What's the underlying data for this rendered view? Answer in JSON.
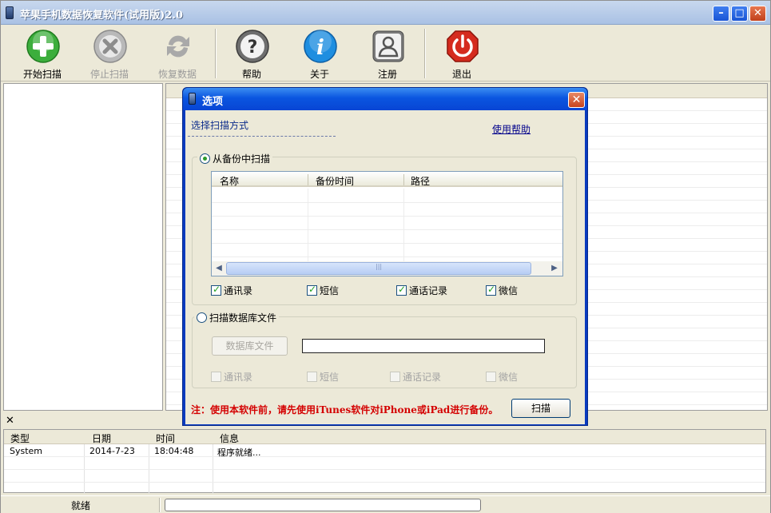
{
  "window": {
    "title": "苹果手机数据恢复软件(试用版)2.0",
    "controls": [
      "minimize",
      "maximize",
      "close"
    ]
  },
  "toolbar": {
    "start_scan": "开始扫描",
    "stop_scan": "停止扫描",
    "recover_data": "恢复数据",
    "help": "帮助",
    "about": "关于",
    "register": "注册",
    "exit": "退出"
  },
  "log": {
    "columns": [
      "类型",
      "日期",
      "时间",
      "信息"
    ],
    "rows": [
      {
        "type": "System",
        "date": "2014-7-23",
        "time": "18:04:48",
        "message": "程序就绪..."
      }
    ]
  },
  "statusbar": {
    "status": "就绪"
  },
  "dialog": {
    "title": "选项",
    "choose_label": "选择扫描方式",
    "help_link": "使用帮助",
    "backup_group": {
      "label": "从备份中扫描",
      "selected": true,
      "columns": [
        "名称",
        "备份时间",
        "路径"
      ],
      "checkboxes": [
        {
          "label": "通讯录",
          "checked": true
        },
        {
          "label": "短信",
          "checked": true
        },
        {
          "label": "通话记录",
          "checked": true
        },
        {
          "label": "微信",
          "checked": true
        }
      ]
    },
    "db_group": {
      "label": "扫描数据库文件",
      "selected": false,
      "file_button": "数据库文件",
      "file_path": "",
      "checkboxes": [
        {
          "label": "通讯录",
          "checked": false
        },
        {
          "label": "短信",
          "checked": false
        },
        {
          "label": "通话记录",
          "checked": false
        },
        {
          "label": "微信",
          "checked": false
        }
      ]
    },
    "note": "注：使用本软件前，请先使用iTunes软件对iPhone或iPad进行备份。",
    "scan_button": "扫描"
  },
  "colors": {
    "dialog_title": "#0a55e0",
    "note": "#d40000",
    "start_icon": "#3cae3c",
    "exit_icon": "#d52b1e",
    "about_icon": "#1e8ee0"
  }
}
